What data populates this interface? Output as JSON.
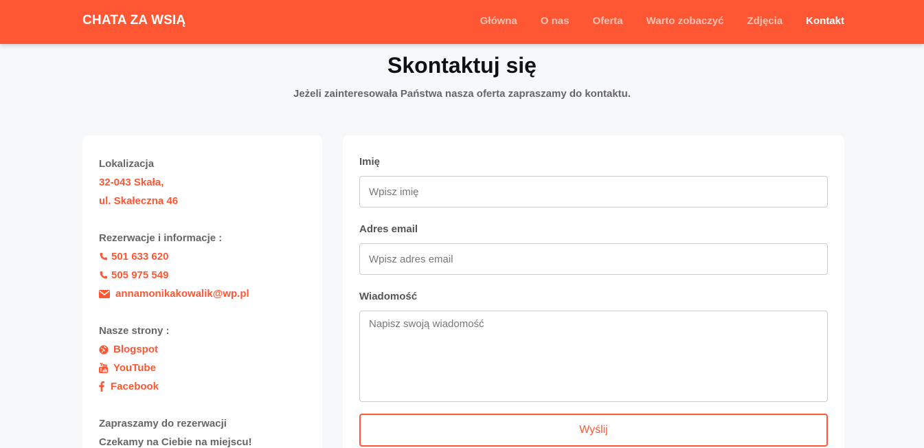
{
  "brand": "CHATA ZA WSIĄ",
  "nav": [
    "Główna",
    "O nas",
    "Oferta",
    "Warto zobaczyć",
    "Zdjęcia",
    "Kontakt"
  ],
  "page": {
    "title": "Skontaktuj się",
    "subtitle": "Jeżeli zainteresowała Państwa nasza oferta zapraszamy do kontaktu."
  },
  "info": {
    "location_heading": "Lokalizacja",
    "address_line1": "32-043 Skała,",
    "address_line2": "ul. Skałeczna 46",
    "contact_heading": "Rezerwacje i informacje :",
    "phone1": "501 633 620",
    "phone2": "505 975 549",
    "email": "annamonikakowalik@wp.pl",
    "sites_heading": "Nasze strony :",
    "sites": [
      "Blogspot",
      "YouTube",
      "Facebook"
    ],
    "footer1": "Zapraszamy do rezerwacji",
    "footer2": "Czekamy na Ciebie na miejscu!"
  },
  "form": {
    "name_label": "Imię",
    "name_placeholder": "Wpisz imię",
    "email_label": "Adres email",
    "email_placeholder": "Wpisz adres email",
    "message_label": "Wiadomość",
    "message_placeholder": "Napisz swoją wiadomość",
    "submit_label": "Wyślij"
  },
  "colors": {
    "accent": "#ff5733",
    "background": "#f7f8fa"
  },
  "icons": [
    "phone-icon",
    "envelope-icon",
    "globe-icon",
    "youtube-icon",
    "facebook-icon"
  ]
}
